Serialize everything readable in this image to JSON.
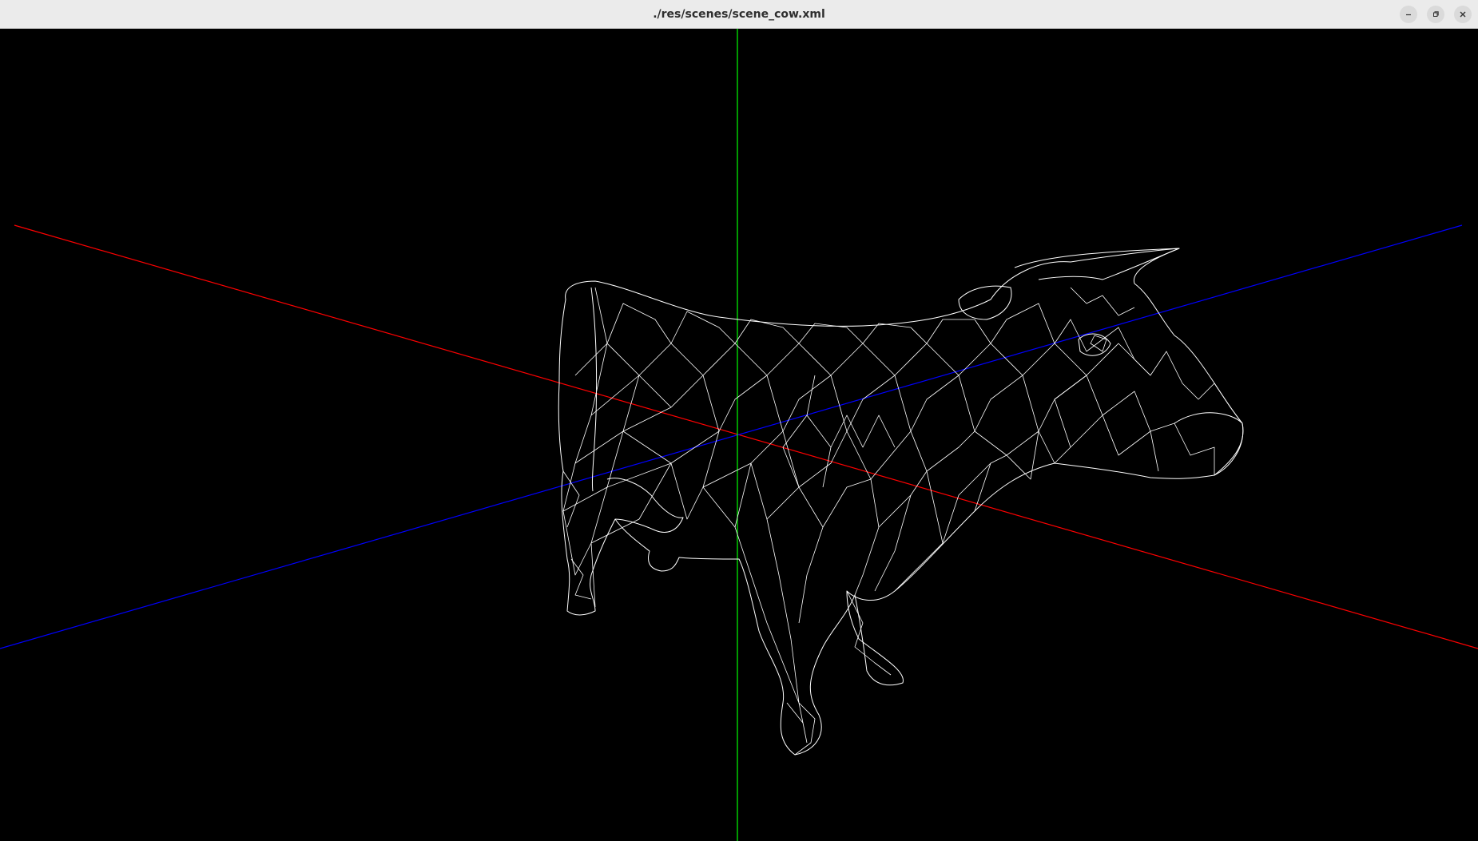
{
  "window": {
    "title": "./res/scenes/scene_cow.xml",
    "controls": [
      {
        "name": "minimize-icon"
      },
      {
        "name": "maximize-icon"
      },
      {
        "name": "close-icon"
      }
    ]
  },
  "scene": {
    "background": "#000000",
    "wireframe_color": "#ffffff",
    "axes": [
      {
        "name": "x-axis",
        "color": "#ff0000"
      },
      {
        "name": "y-axis",
        "color": "#00ff00"
      },
      {
        "name": "z-axis",
        "color": "#0000ff"
      }
    ],
    "model": "cow-wireframe"
  }
}
